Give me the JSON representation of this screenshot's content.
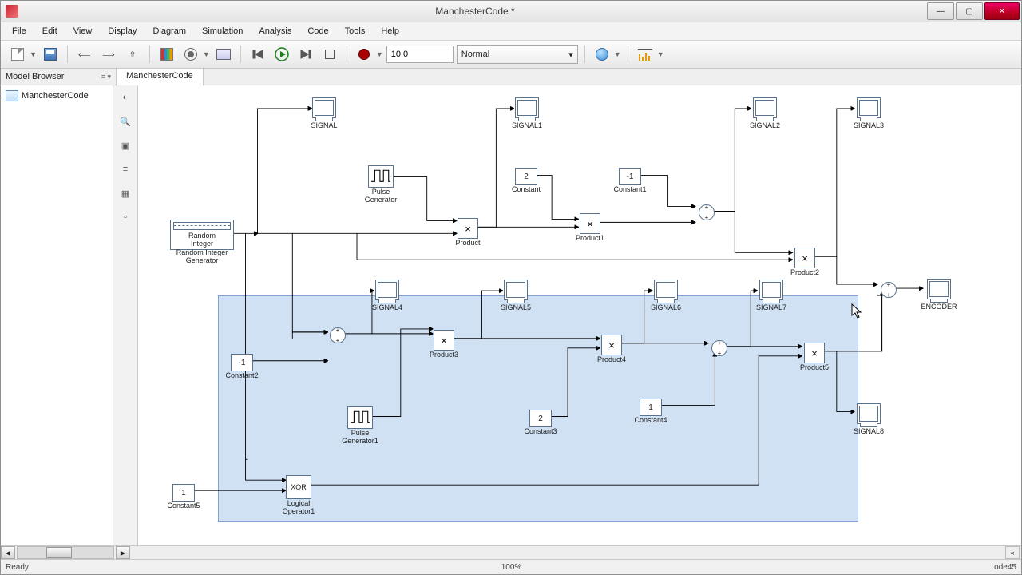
{
  "window": {
    "title": "ManchesterCode *"
  },
  "menu": [
    "File",
    "Edit",
    "View",
    "Display",
    "Diagram",
    "Simulation",
    "Analysis",
    "Code",
    "Tools",
    "Help"
  ],
  "toolbar": {
    "sim_time": "10.0",
    "sim_mode": "Normal"
  },
  "browser": {
    "title": "Model Browser",
    "root": "ManchesterCode"
  },
  "tab": "ManchesterCode",
  "status": {
    "left": "Ready",
    "center": "100%",
    "right": "ode45"
  },
  "blocks": {
    "random_integer": {
      "line1": "Random",
      "line2": "Integer",
      "label": "Random Integer\nGenerator"
    },
    "pulse_generator": {
      "label": "Pulse\nGenerator"
    },
    "pulse_generator1": {
      "label": "Pulse\nGenerator1"
    },
    "scope_signal": {
      "label": "SIGNAL"
    },
    "scope_signal1": {
      "label": "SIGNAL1"
    },
    "scope_signal2": {
      "label": "SIGNAL2"
    },
    "scope_signal3": {
      "label": "SIGNAL3"
    },
    "scope_signal4": {
      "label": "SIGNAL4"
    },
    "scope_signal5": {
      "label": "SIGNAL5"
    },
    "scope_signal6": {
      "label": "SIGNAL6"
    },
    "scope_signal7": {
      "label": "SIGNAL7"
    },
    "scope_signal8": {
      "label": "SIGNAL8"
    },
    "scope_encoder": {
      "label": "ENCODER"
    },
    "constant": {
      "value": "2",
      "label": "Constant"
    },
    "constant1": {
      "value": "-1",
      "label": "Constant1"
    },
    "constant2": {
      "value": "-1",
      "label": "Constant2"
    },
    "constant3": {
      "value": "2",
      "label": "Constant3"
    },
    "constant4": {
      "value": "1",
      "label": "Constant4"
    },
    "constant5": {
      "value": "1",
      "label": "Constant5"
    },
    "product": {
      "label": "Product"
    },
    "product1": {
      "label": "Product1"
    },
    "product2": {
      "label": "Product2"
    },
    "product3": {
      "label": "Product3"
    },
    "product4": {
      "label": "Product4"
    },
    "product5": {
      "label": "Product5"
    },
    "xor": {
      "text": "XOR",
      "label": "Logical\nOperator1"
    }
  }
}
